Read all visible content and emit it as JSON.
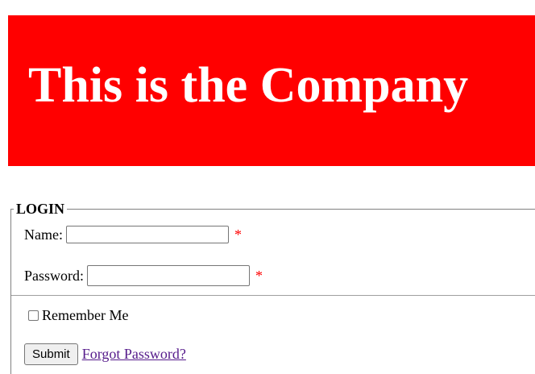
{
  "header": {
    "title": "This is the Company",
    "background_color": "#ff0000",
    "text_color": "#ffffff"
  },
  "login": {
    "legend": "LOGIN",
    "name_label": "Name:",
    "name_value": "",
    "password_label": "Password:",
    "password_value": "",
    "required_marker": "*",
    "required_color": "#ff0000",
    "remember_label": "Remember Me",
    "remember_checked": false,
    "submit_label": "Submit",
    "forgot_link": "Forgot Password?",
    "link_color": "#551a8b"
  }
}
